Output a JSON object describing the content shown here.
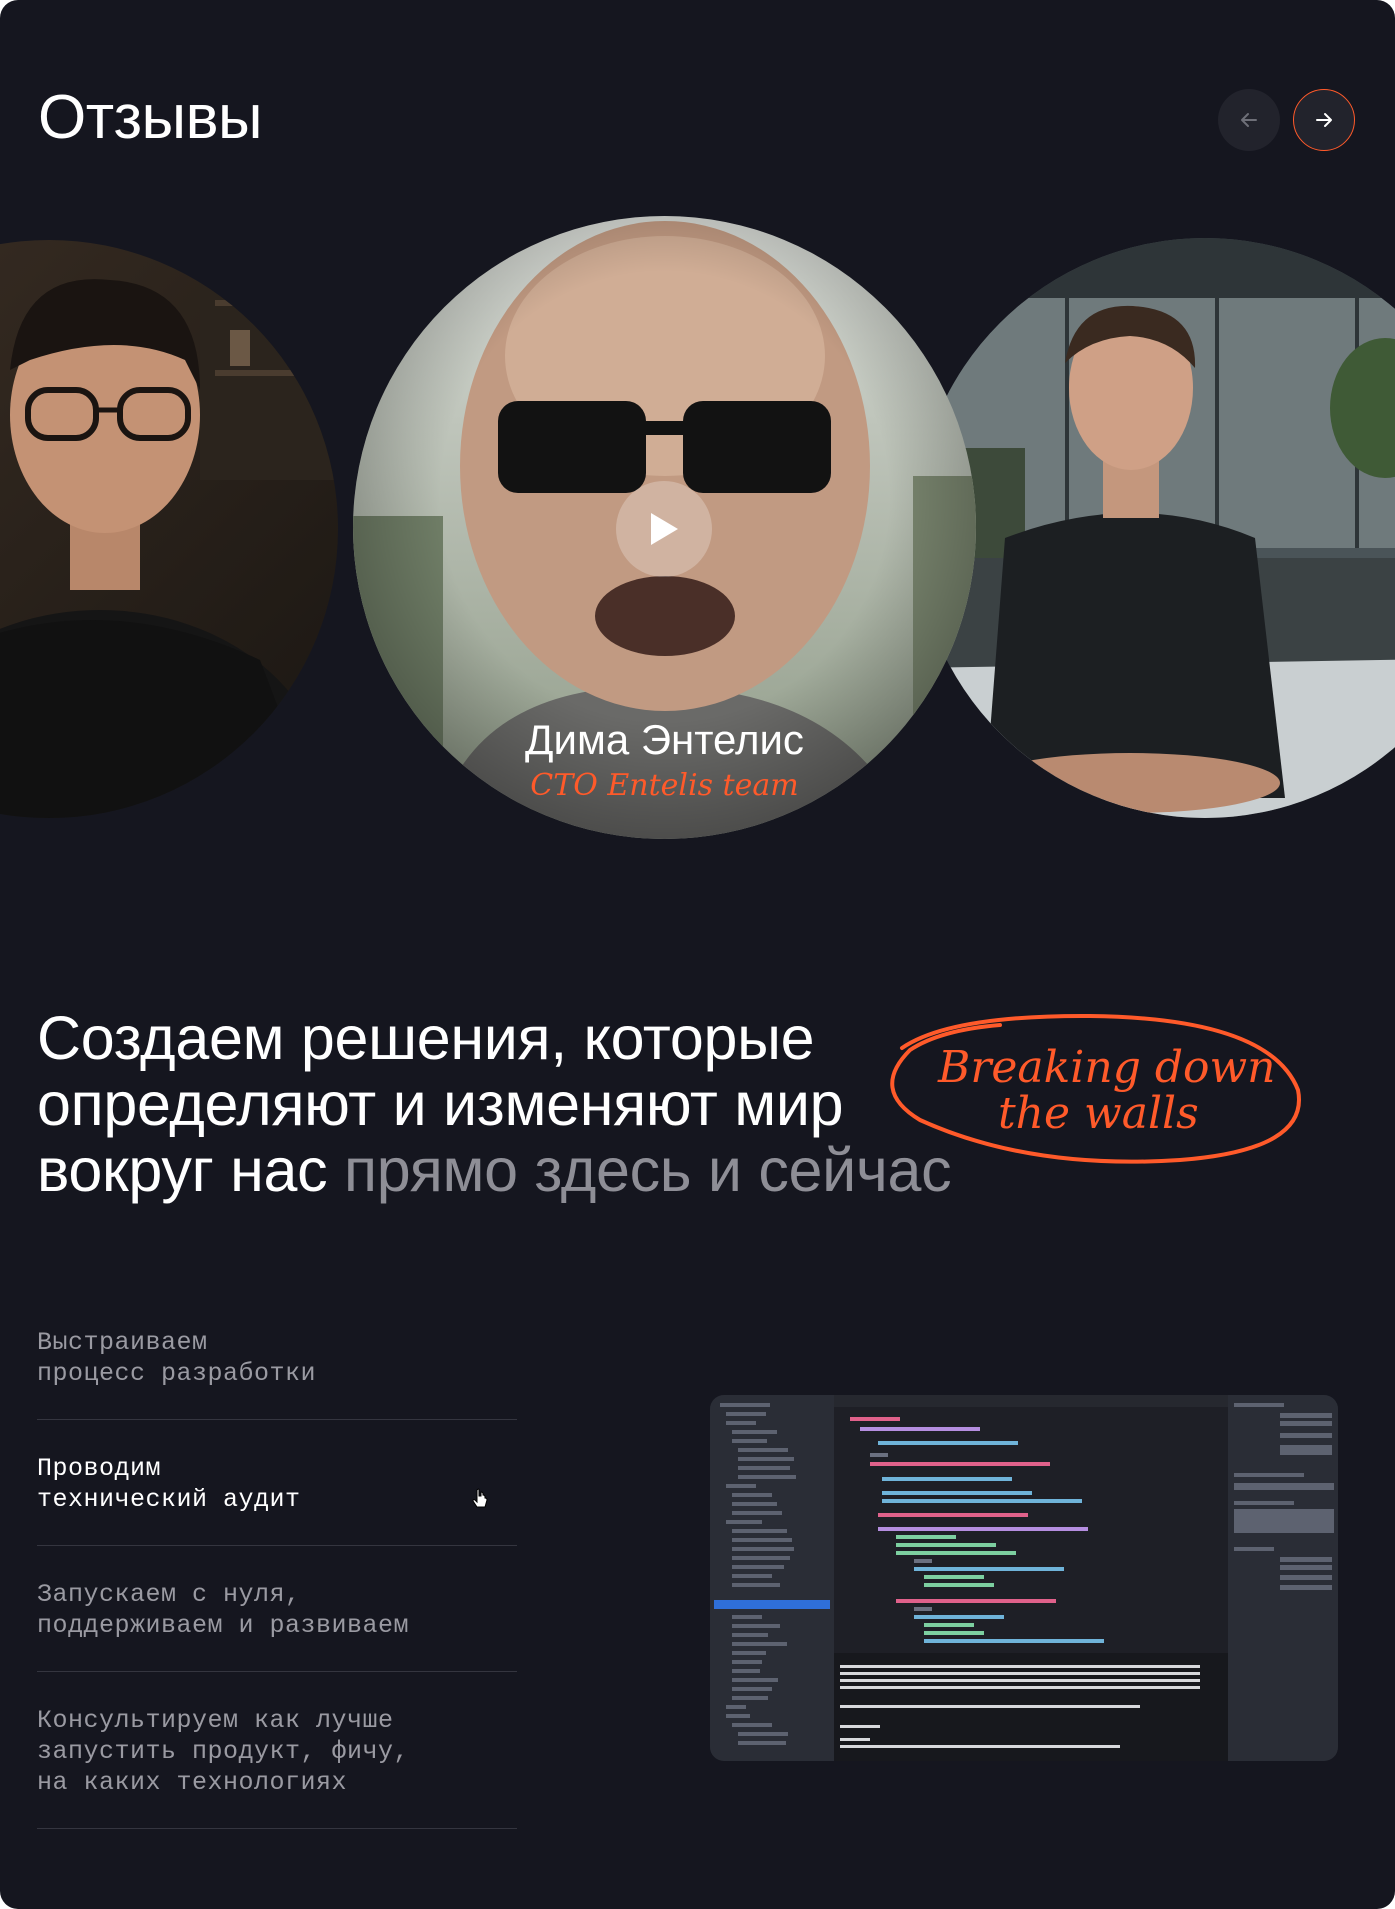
{
  "header": {
    "title": "Отзывы"
  },
  "nav": {
    "prev_icon": "arrow-left-icon",
    "next_icon": "arrow-right-icon",
    "accent": "#ff5a2a"
  },
  "testimonial": {
    "name": "Дима Энтелис",
    "role": "CTO Entelis team",
    "play_icon": "play-icon"
  },
  "headline": {
    "line1": "Создаем решения, которые",
    "line2": "определяют и изменяют мир",
    "line3_main": "вокруг нас",
    "line3_muted": "прямо здесь и сейчас",
    "scribble_line1": "Breaking down",
    "scribble_line2": "the walls"
  },
  "services": [
    {
      "line1": "Выстраиваем",
      "line2": "процесс разработки",
      "active": false
    },
    {
      "line1": "Проводим",
      "line2": "технический аудит",
      "active": true
    },
    {
      "line1": "Запускаем с нуля,",
      "line2": "поддерживаем и развиваем",
      "active": false
    },
    {
      "line1": "Консультируем как лучше",
      "line2": "запустить продукт, фичу,",
      "line3": "на каких технологиях",
      "active": false
    }
  ],
  "colors": {
    "background": "#15161f",
    "accent": "#ff5a2a",
    "muted_text": "#8e8e96"
  }
}
